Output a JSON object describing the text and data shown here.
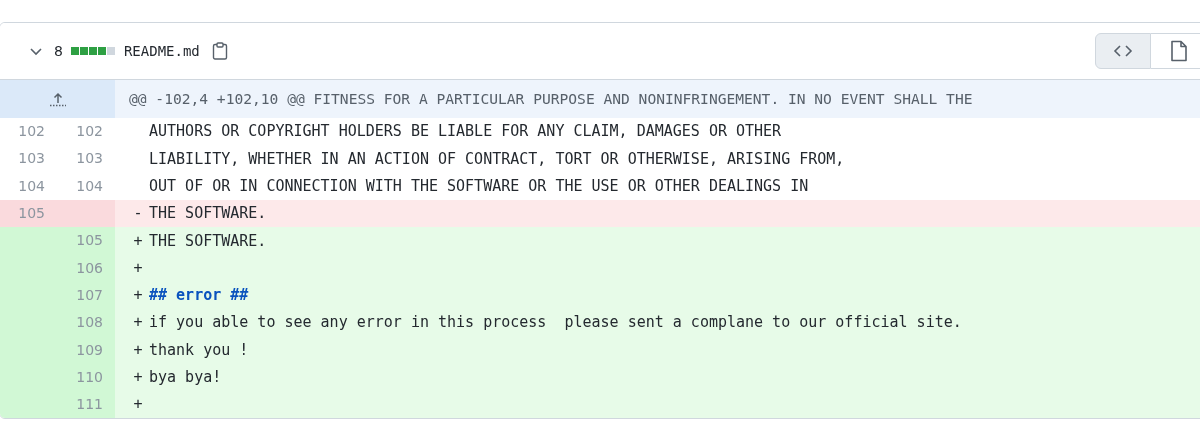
{
  "file": {
    "expanded": true,
    "changes": "8",
    "name": "README.md",
    "stat": [
      {
        "kind": "added"
      },
      {
        "kind": "added"
      },
      {
        "kind": "added"
      },
      {
        "kind": "added"
      },
      {
        "kind": "neutral"
      }
    ],
    "views": [
      {
        "kind": "source",
        "selected": true
      },
      {
        "kind": "rich",
        "selected": false
      }
    ]
  },
  "hunk": {
    "header": "@@ -102,4 +102,10 @@ FITNESS FOR A PARTICULAR PURPOSE AND NONINFRINGEMENT. IN NO EVENT SHALL THE"
  },
  "lines": [
    {
      "kind": "context",
      "old": "102",
      "new": "102",
      "text": "AUTHORS OR COPYRIGHT HOLDERS BE LIABLE FOR ANY CLAIM, DAMAGES OR OTHER"
    },
    {
      "kind": "context",
      "old": "103",
      "new": "103",
      "text": "LIABILITY, WHETHER IN AN ACTION OF CONTRACT, TORT OR OTHERWISE, ARISING FROM,"
    },
    {
      "kind": "context",
      "old": "104",
      "new": "104",
      "text": "OUT OF OR IN CONNECTION WITH THE SOFTWARE OR THE USE OR OTHER DEALINGS IN"
    },
    {
      "kind": "deletion",
      "old": "105",
      "marker": "-",
      "text": "THE SOFTWARE."
    },
    {
      "kind": "addition",
      "new": "105",
      "marker": "+",
      "text": "THE SOFTWARE."
    },
    {
      "kind": "addition",
      "new": "106",
      "marker": "+"
    },
    {
      "kind": "addition",
      "new": "107",
      "marker": "+",
      "text": "## error ##",
      "heading": true
    },
    {
      "kind": "addition",
      "new": "108",
      "marker": "+",
      "text": "if you able to see any error in this process  please sent a complane to our official site."
    },
    {
      "kind": "addition",
      "new": "109",
      "marker": "+",
      "text": "thank you !"
    },
    {
      "kind": "addition",
      "new": "110",
      "marker": "+",
      "text": "bya bya!"
    },
    {
      "kind": "addition",
      "new": "111",
      "marker": "+"
    }
  ]
}
